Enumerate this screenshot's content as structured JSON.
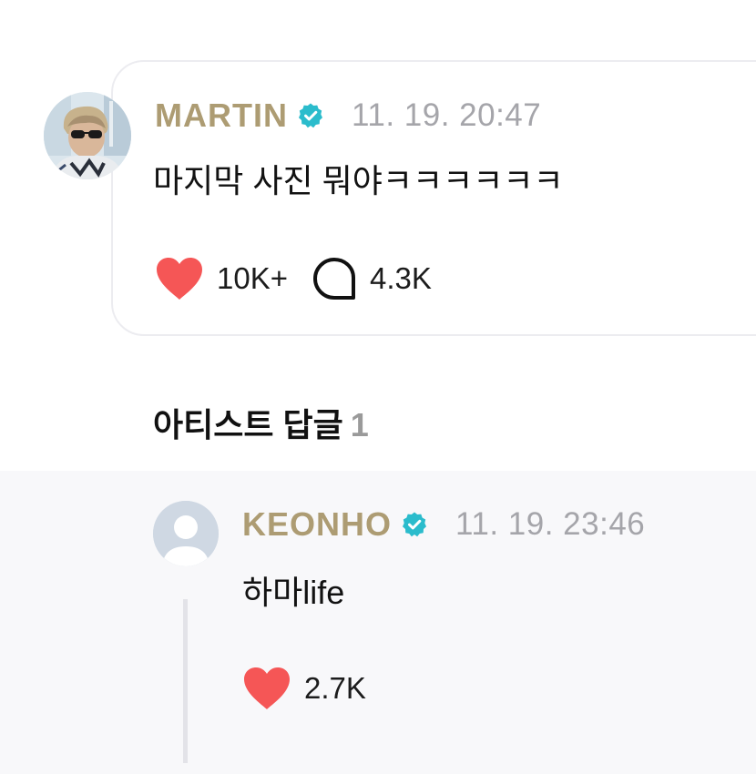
{
  "post": {
    "author": "MARTIN",
    "timestamp": "11. 19. 20:47",
    "text": "마지막 사진 뭐야ㅋㅋㅋㅋㅋㅋ",
    "likes": "10K+",
    "comments": "4.3K"
  },
  "artist_replies": {
    "title": "아티스트 답글",
    "count": "1"
  },
  "reply": {
    "author": "KEONHO",
    "timestamp": "11. 19. 23:46",
    "text": "하마life",
    "likes": "2.7K"
  },
  "colors": {
    "author_name": "#ad9c73",
    "verified_badge": "#2bbccc",
    "heart": "#f55656",
    "timestamp": "#a5a5aa"
  },
  "icons": {
    "verified": "verified-badge-icon",
    "like": "heart-icon",
    "comment": "comment-bubble-icon",
    "default_avatar": "default-user-avatar"
  }
}
